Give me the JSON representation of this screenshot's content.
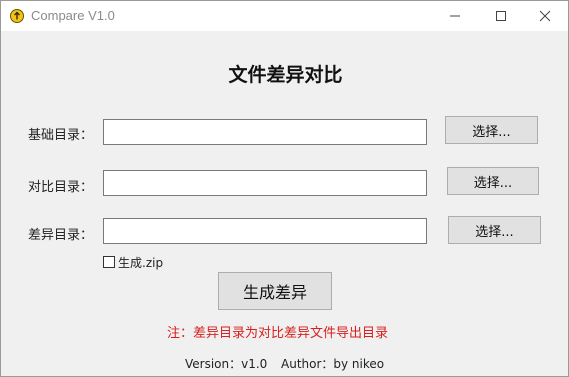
{
  "window": {
    "title": "Compare V1.0",
    "minimize_icon": "minimize-icon",
    "maximize_icon": "maximize-icon",
    "close_icon": "close-icon"
  },
  "main": {
    "heading": "文件差异对比",
    "rows": [
      {
        "label": "基础目录：",
        "value": "",
        "button": "选择..."
      },
      {
        "label": "对比目录：",
        "value": "",
        "button": "选择..."
      },
      {
        "label": "差异目录：",
        "value": "",
        "button": "选择..."
      }
    ],
    "checkbox_label": "生成.zip",
    "checkbox_checked": false,
    "generate_button": "生成差异",
    "note": "注：差异目录为对比差异文件导出目录"
  },
  "footer": {
    "version": "Version：v1.0",
    "author": "Author：by nikeo"
  },
  "colors": {
    "note": "#d81e1e",
    "titlebar": "#ffffff",
    "background": "#f0f0f0"
  }
}
